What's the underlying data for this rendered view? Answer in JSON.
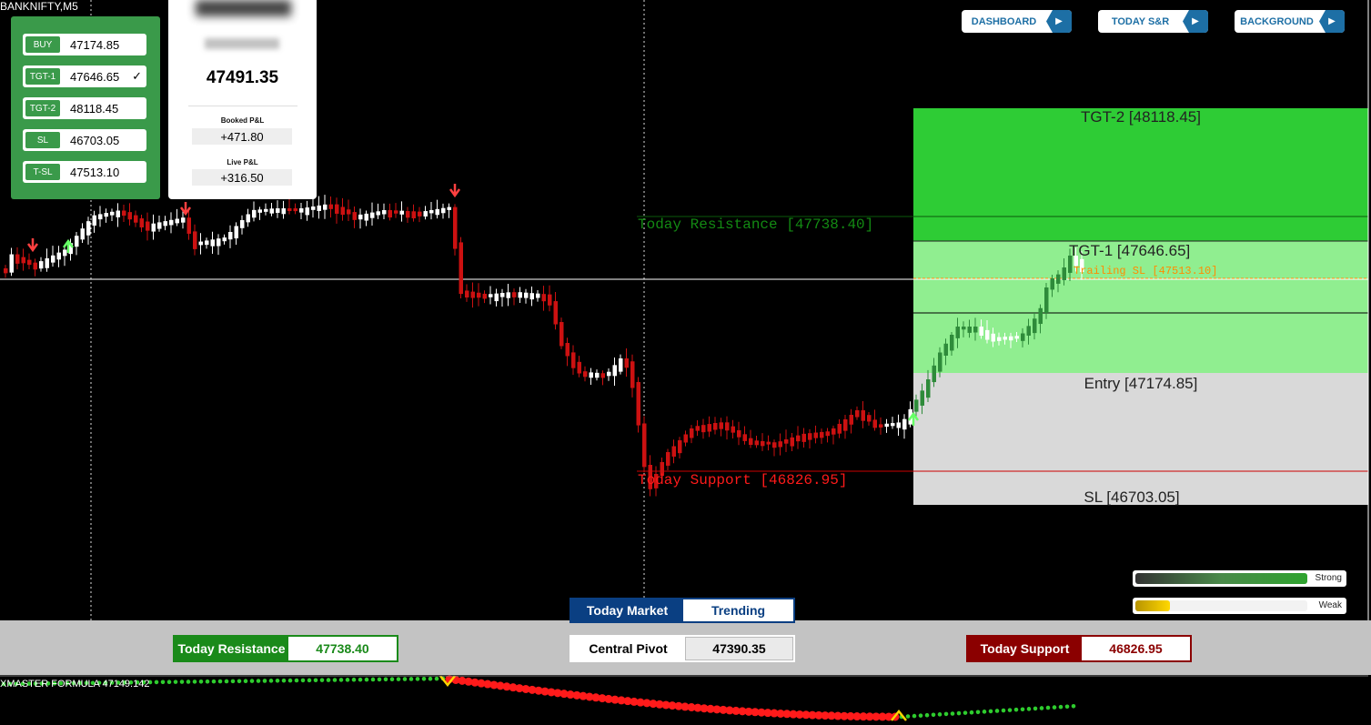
{
  "symbol": "BANKNIFTY,M5",
  "trade_panel": {
    "rows": [
      {
        "tag": "BUY",
        "value": "47174.85",
        "checked": false
      },
      {
        "tag": "TGT-1",
        "value": "47646.65",
        "checked": true
      },
      {
        "tag": "TGT-2",
        "value": "48118.45",
        "checked": false
      },
      {
        "tag": "SL",
        "value": "46703.05",
        "checked": false
      },
      {
        "tag": "T-SL",
        "value": "47513.10",
        "checked": false
      }
    ],
    "check_mark": "✓"
  },
  "pnl_card": {
    "price": "47491.35",
    "booked_label": "Booked P&L",
    "booked_value": "+471.80",
    "live_label": "Live P&L",
    "live_value": "+316.50"
  },
  "nav": {
    "dashboard": "DASHBOARD",
    "today_sr": "TODAY S&R",
    "background": "BACKGROUND",
    "arrow_icon": "▶"
  },
  "zones": {
    "tgt2": "TGT-2 [48118.45]",
    "tgt1": "TGT-1 [47646.65]",
    "trailing": "Trailing SL [47513.10]",
    "entry": "Entry [47174.85]",
    "sl": "SL [46703.05]"
  },
  "levels": {
    "resistance": "Today Resistance [47738.40]",
    "support": "Today Support [46826.95]"
  },
  "strength": {
    "strong_label": "Strong",
    "weak_label": "Weak",
    "strong_level": 1.0,
    "weak_level": 0.2
  },
  "bottom": {
    "market_label": "Today Market",
    "market_value": "Trending",
    "resistance_label": "Today Resistance",
    "resistance_value": "47738.40",
    "pivot_label": "Central Pivot",
    "pivot_value": "47390.35",
    "support_label": "Today Support",
    "support_value": "46826.95"
  },
  "formula": "XMASTER FORMULA 47149.142",
  "colors": {
    "panel_green": "#3a9a4a",
    "bull": "#2e8b3a",
    "bear": "#cc1111",
    "nav_blue": "#1d6fa5",
    "zone_tgt2": "#2ecc35",
    "zone_tgt1": "#90ee90",
    "zone_entry": "#d9d9d9",
    "trailing": "#ff8c00",
    "resistance": "#138a13",
    "support": "#ff1a1a"
  }
}
